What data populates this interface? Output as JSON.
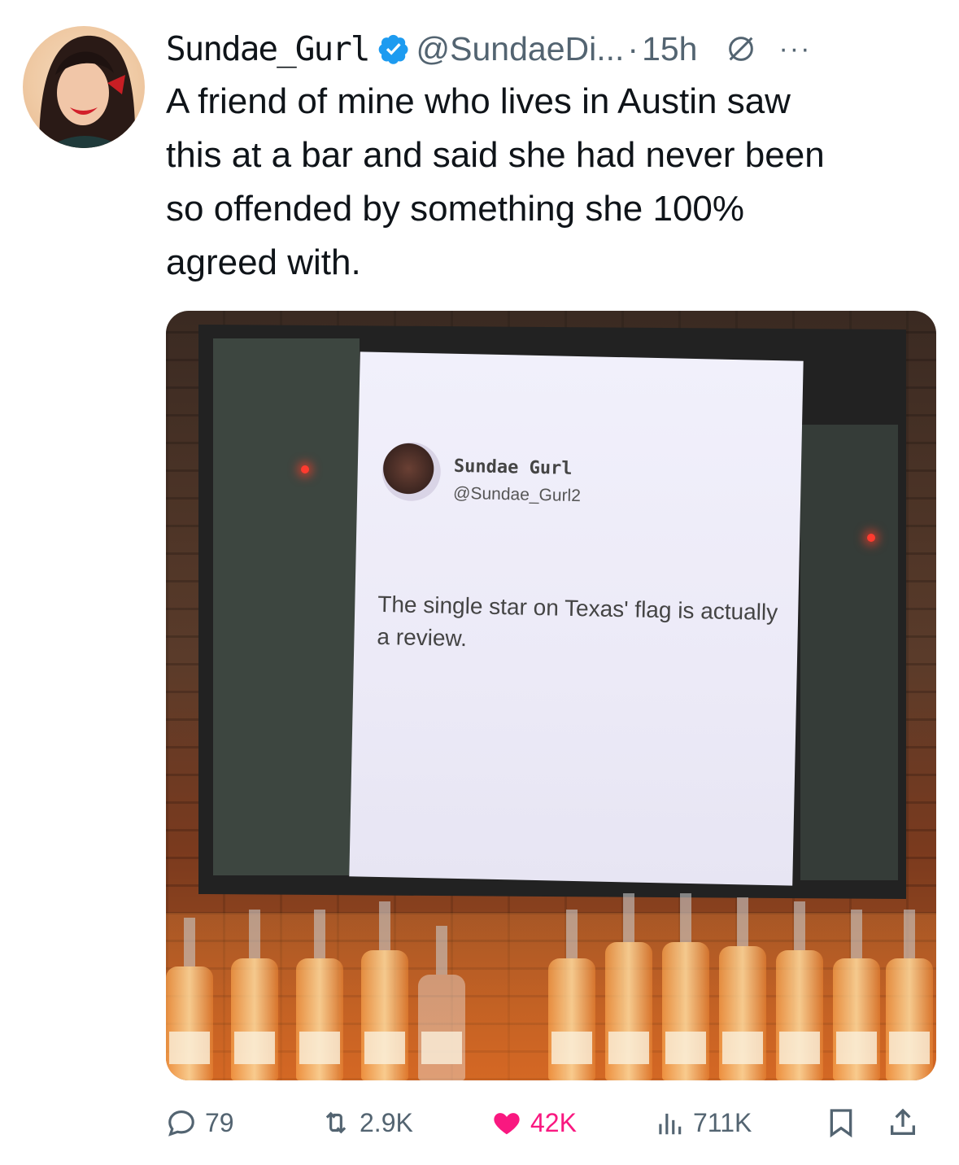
{
  "author": {
    "display_name": "Sundae_Gurl",
    "handle": "@SundaeDi...",
    "separator": "·",
    "time": "15h",
    "more_label": "···"
  },
  "tweet": {
    "text": "A friend of mine who lives in Austin saw\nthis at a bar and said she had never been\nso offended by something she 100%\nagreed with."
  },
  "media": {
    "screen_name": "Sundae Gurl",
    "screen_handle": "@Sundae_Gurl2",
    "screen_text": "The single star on Texas' flag is actually a review."
  },
  "actions": {
    "replies": "79",
    "reposts": "2.9K",
    "likes": "42K",
    "views": "711K"
  },
  "colors": {
    "verified": "#1d9bf0",
    "like": "#f91880",
    "muted": "#536471"
  }
}
